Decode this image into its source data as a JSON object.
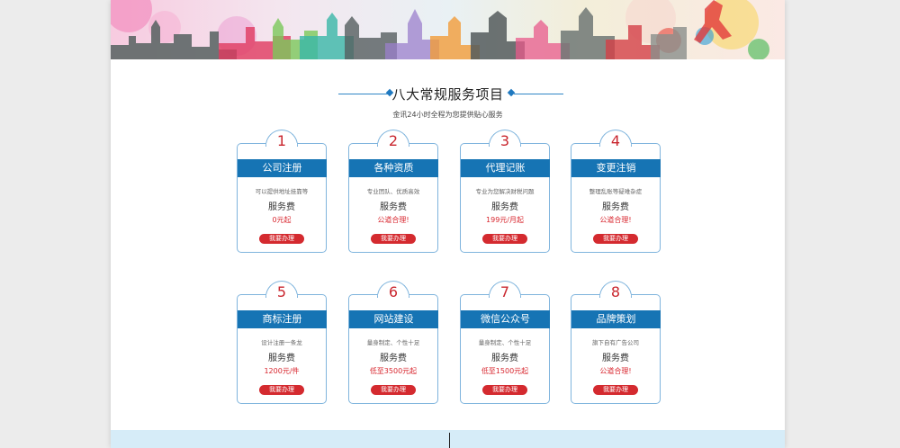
{
  "section": {
    "title": "八大常规服务项目",
    "subtitle": "金讯24小时全程为您提供贴心服务"
  },
  "cards": [
    {
      "num": "1",
      "title": "公司注册",
      "desc": "可以提供地址挂靠等",
      "fee": "服务费",
      "price": "0元起",
      "button": "我要办理"
    },
    {
      "num": "2",
      "title": "各种资质",
      "desc": "专业团队、优质高效",
      "fee": "服务费",
      "price": "公道合理!",
      "button": "我要办理"
    },
    {
      "num": "3",
      "title": "代理记账",
      "desc": "专业为您解决财税问题",
      "fee": "服务费",
      "price": "199元/月起",
      "button": "我要办理"
    },
    {
      "num": "4",
      "title": "变更注销",
      "desc": "整理乱账等疑难杂症",
      "fee": "服务费",
      "price": "公道合理!",
      "button": "我要办理"
    },
    {
      "num": "5",
      "title": "商标注册",
      "desc": "设计注册一条龙",
      "fee": "服务费",
      "price": "1200元/件",
      "button": "我要办理"
    },
    {
      "num": "6",
      "title": "网站建设",
      "desc": "量身制定、个性十足",
      "fee": "服务费",
      "price": "低至3500元起",
      "button": "我要办理"
    },
    {
      "num": "7",
      "title": "微信公众号",
      "desc": "量身制定、个性十足",
      "fee": "服务费",
      "price": "低至1500元起",
      "button": "我要办理"
    },
    {
      "num": "8",
      "title": "品牌策划",
      "desc": "旗下自有广告公司",
      "fee": "服务费",
      "price": "公道合理!",
      "button": "我要办理"
    }
  ],
  "colors": {
    "accent_blue": "#1674b4",
    "accent_red": "#d42a2f",
    "border_blue": "#7fb4dd"
  }
}
